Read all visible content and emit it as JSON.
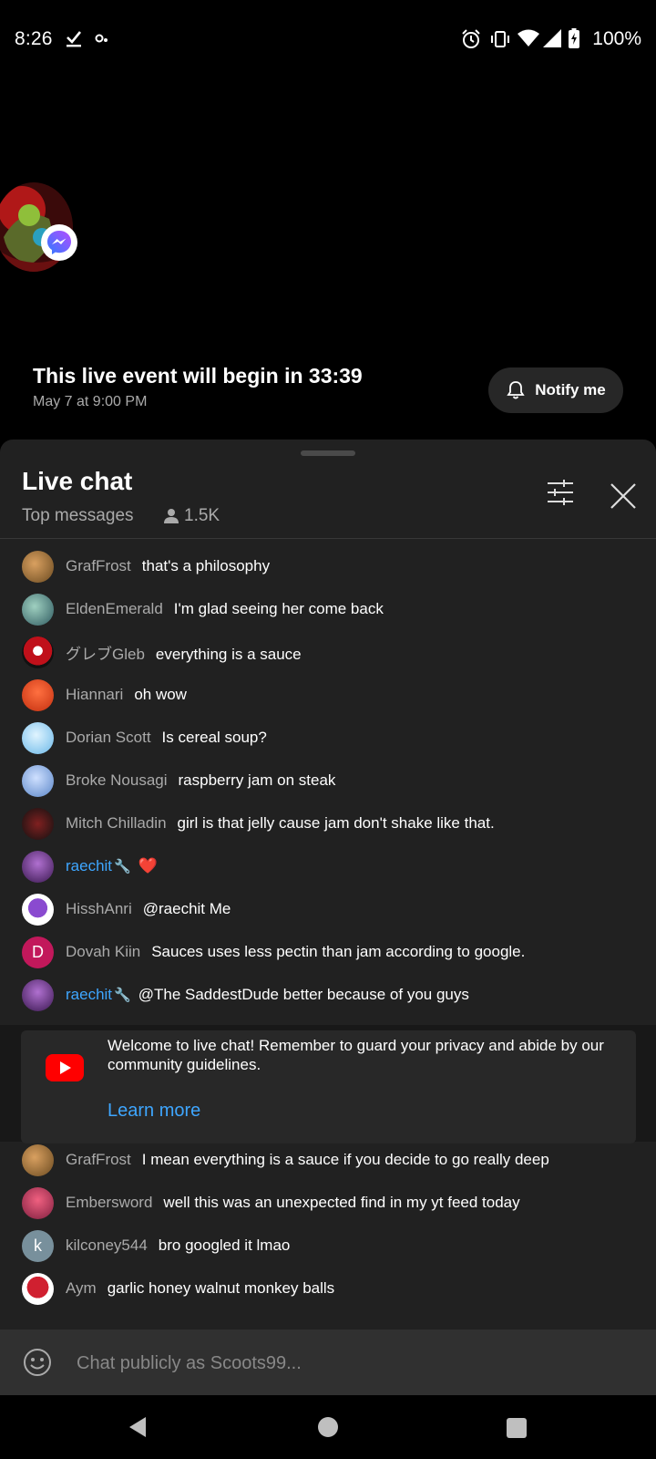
{
  "status": {
    "time": "8:26",
    "battery": "100%",
    "icons": [
      "download-done-icon",
      "cloud-icon",
      "alarm-icon",
      "vibrate-icon",
      "wifi-icon",
      "signal-icon",
      "battery-icon"
    ]
  },
  "video": {
    "title": "This live event will begin in 33:39",
    "date": "May 7 at 9:00 PM",
    "notify_label": "Notify me"
  },
  "chat": {
    "title": "Live chat",
    "mode": "Top messages",
    "viewers": "1.5K",
    "messages": [
      {
        "author": "GrafFrost",
        "text": "that's a philosophy"
      },
      {
        "author": "EldenEmerald",
        "text": "I'm glad seeing her come back"
      },
      {
        "author": "グレブGleb",
        "text": "everything is a sauce"
      },
      {
        "author": "Hiannari",
        "text": "oh wow"
      },
      {
        "author": "Dorian Scott",
        "text": "Is cereal soup?"
      },
      {
        "author": "Broke Nousagi",
        "text": "raspberry jam on steak"
      },
      {
        "author": "Mitch Chilladin",
        "text": "girl is that jelly cause jam don't shake like that."
      },
      {
        "author": "raechit",
        "text": "❤️",
        "moderator": true
      },
      {
        "author": "HisshAnri",
        "text": "@raechit Me"
      },
      {
        "author": "Dovah Kiin",
        "text": "Sauces uses less pectin than jam according to google.",
        "initial": "D"
      },
      {
        "author": "raechit",
        "text": "@The SaddestDude better because of you guys",
        "moderator": true
      },
      {
        "author": "GrafFrost",
        "text": "I mean everything is a sauce if you decide to go really deep"
      },
      {
        "author": "Embersword",
        "text": "well this was an unexpected find in my yt feed today"
      },
      {
        "author": "kilconey544",
        "text": "bro googled it lmao",
        "initial": "k"
      },
      {
        "author": "Aym",
        "text": "garlic honey walnut monkey balls"
      }
    ],
    "welcome": {
      "text": "Welcome to live chat! Remember to guard your privacy and abide by our community guidelines.",
      "link": "Learn more"
    },
    "input_placeholder": "Chat publicly as Scoots99...",
    "colors": {
      "accent": "#3ea6ff",
      "sheet": "#212121",
      "brand": "#ff0000"
    }
  }
}
